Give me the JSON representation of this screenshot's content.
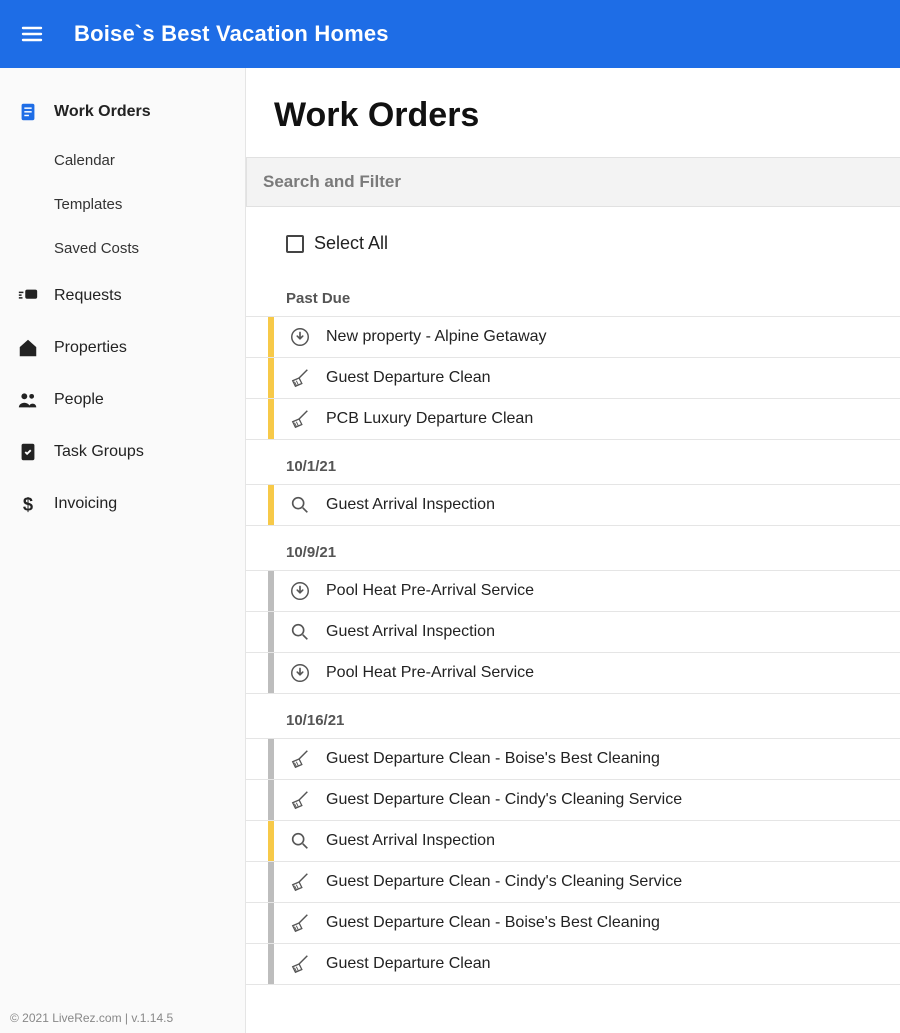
{
  "header": {
    "title": "Boise`s Best Vacation Homes"
  },
  "sidebar": {
    "items": [
      {
        "label": "Work Orders",
        "icon": "clipboard",
        "active": true,
        "children": [
          {
            "label": "Calendar"
          },
          {
            "label": "Templates"
          },
          {
            "label": "Saved Costs"
          }
        ]
      },
      {
        "label": "Requests",
        "icon": "chat"
      },
      {
        "label": "Properties",
        "icon": "home"
      },
      {
        "label": "People",
        "icon": "people"
      },
      {
        "label": "Task Groups",
        "icon": "checklist"
      },
      {
        "label": "Invoicing",
        "icon": "dollar"
      }
    ],
    "footer": "© 2021 LiveRez.com | v.1.14.5"
  },
  "main": {
    "title": "Work Orders",
    "search_label": "Search and Filter",
    "select_all_label": "Select All",
    "groups": [
      {
        "label": "Past Due",
        "rows": [
          {
            "icon": "download",
            "stripe": "yellow",
            "label": "New property - Alpine Getaway"
          },
          {
            "icon": "broom",
            "stripe": "yellow",
            "label": "Guest Departure Clean"
          },
          {
            "icon": "broom",
            "stripe": "yellow",
            "label": "PCB Luxury Departure Clean"
          }
        ]
      },
      {
        "label": "10/1/21",
        "rows": [
          {
            "icon": "search",
            "stripe": "yellow",
            "label": "Guest Arrival Inspection"
          }
        ]
      },
      {
        "label": "10/9/21",
        "rows": [
          {
            "icon": "download",
            "stripe": "grey",
            "label": "Pool Heat Pre-Arrival Service"
          },
          {
            "icon": "search",
            "stripe": "grey",
            "label": "Guest Arrival Inspection"
          },
          {
            "icon": "download",
            "stripe": "grey",
            "label": "Pool Heat Pre-Arrival Service"
          }
        ]
      },
      {
        "label": "10/16/21",
        "rows": [
          {
            "icon": "broom",
            "stripe": "grey",
            "label": "Guest Departure Clean - Boise's Best Cleaning"
          },
          {
            "icon": "broom",
            "stripe": "grey",
            "label": "Guest Departure Clean - Cindy's Cleaning Service"
          },
          {
            "icon": "search",
            "stripe": "yellow",
            "label": "Guest Arrival Inspection"
          },
          {
            "icon": "broom",
            "stripe": "grey",
            "label": "Guest Departure Clean - Cindy's Cleaning Service"
          },
          {
            "icon": "broom",
            "stripe": "grey",
            "label": "Guest Departure Clean - Boise's Best Cleaning"
          },
          {
            "icon": "broom",
            "stripe": "grey",
            "label": "Guest Departure Clean"
          }
        ]
      }
    ]
  }
}
